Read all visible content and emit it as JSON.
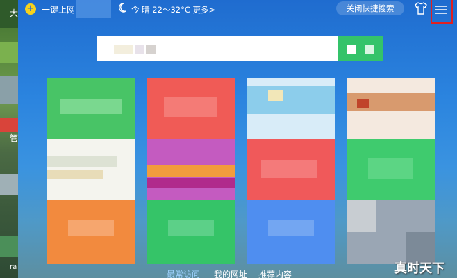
{
  "header": {
    "logo_glyph": "+",
    "title": "一键上网",
    "weather_icon": "moon-icon",
    "weather_text": "今  晴 22～32°C 更多>",
    "quick_search_label": "关闭快捷搜索",
    "skin_icon": "shirt-icon",
    "menu_icon": "menu-icon",
    "menu_highlight_color": "#e02020"
  },
  "desktop": {
    "labels": [
      "大",
      "管",
      "ra"
    ]
  },
  "search": {
    "button_color": "#34c36a"
  },
  "tiles": [
    {
      "name": "tile-1",
      "color": "#48c466"
    },
    {
      "name": "tile-2",
      "color": "#f05b56"
    },
    {
      "name": "tile-3",
      "color": "#d8ecf8"
    },
    {
      "name": "tile-4",
      "color": "#f4e9df"
    },
    {
      "name": "tile-5",
      "color": "#f4f4ee"
    },
    {
      "name": "tile-6",
      "color": "#c45bc0"
    },
    {
      "name": "tile-7",
      "color": "#f0595a"
    },
    {
      "name": "tile-8",
      "color": "#3fcb6e"
    },
    {
      "name": "tile-9",
      "color": "#f28a3e"
    },
    {
      "name": "tile-10",
      "color": "#35c468"
    },
    {
      "name": "tile-11",
      "color": "#4f8ef0"
    },
    {
      "name": "tile-12",
      "color": "#9aa6b4"
    }
  ],
  "footer": {
    "tabs": [
      "最常访问",
      "我的网址",
      "推荐内容"
    ]
  },
  "watermark": "真时天下"
}
